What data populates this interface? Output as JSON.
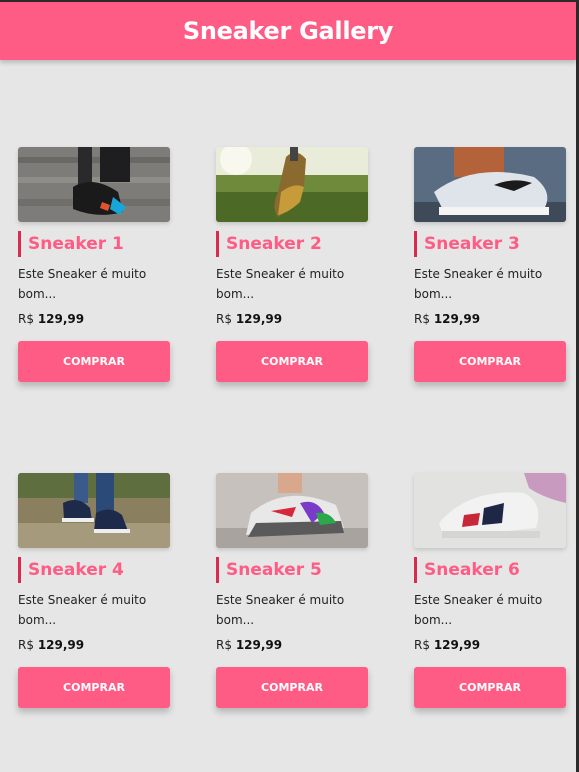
{
  "header": {
    "title": "Sneaker Gallery"
  },
  "colors": {
    "accent": "#ff5c85",
    "title_bar": "#dc2a4e",
    "background": "#e6e6e6"
  },
  "products": [
    {
      "name": "Sneaker 1",
      "description": "Este Sneaker é muito bom...",
      "currency": "R$",
      "price": "129,99",
      "button": "COMPRAR",
      "image": "shoe-photo-1"
    },
    {
      "name": "Sneaker 2",
      "description": "Este Sneaker é muito bom...",
      "currency": "R$",
      "price": "129,99",
      "button": "COMPRAR",
      "image": "shoe-photo-2"
    },
    {
      "name": "Sneaker 3",
      "description": "Este Sneaker é muito bom...",
      "currency": "R$",
      "price": "129,99",
      "button": "COMPRAR",
      "image": "shoe-photo-3"
    },
    {
      "name": "Sneaker 4",
      "description": "Este Sneaker é muito bom...",
      "currency": "R$",
      "price": "129,99",
      "button": "COMPRAR",
      "image": "shoe-photo-4"
    },
    {
      "name": "Sneaker 5",
      "description": "Este Sneaker é muito bom...",
      "currency": "R$",
      "price": "129,99",
      "button": "COMPRAR",
      "image": "shoe-photo-5"
    },
    {
      "name": "Sneaker 6",
      "description": "Este Sneaker é muito bom...",
      "currency": "R$",
      "price": "129,99",
      "button": "COMPRAR",
      "image": "shoe-photo-6"
    }
  ]
}
